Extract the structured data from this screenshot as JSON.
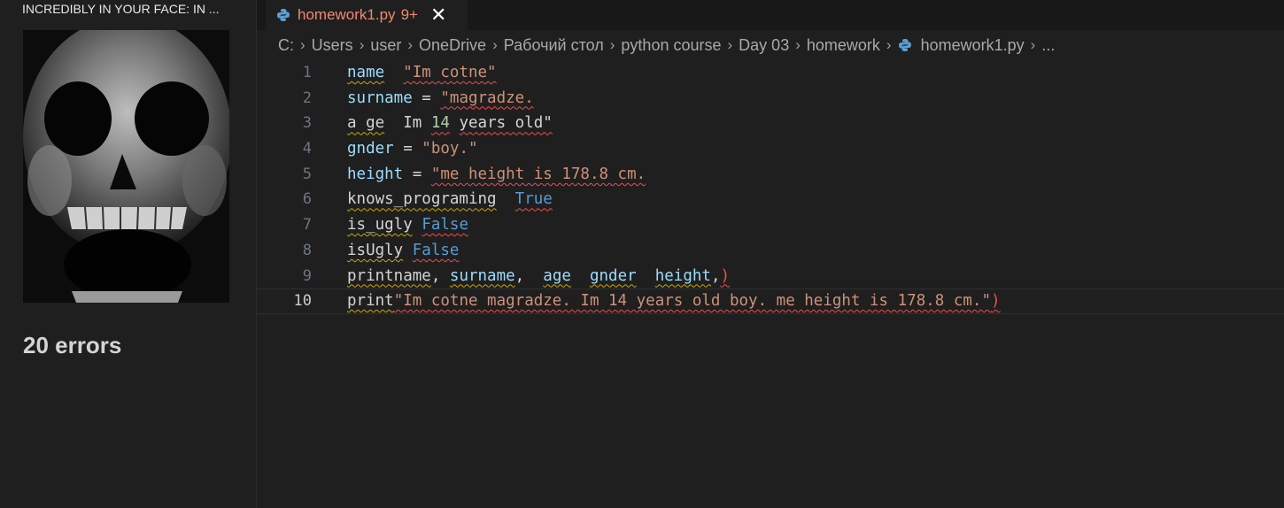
{
  "video_panel": {
    "title": "INCREDIBLY IN YOUR FACE: IN ...",
    "error_count": "20 errors"
  },
  "tab": {
    "filename": "homework1.py",
    "badge": "9+",
    "close_glyph": "✕"
  },
  "breadcrumb": [
    "C:",
    "Users",
    "user",
    "OneDrive",
    "Рабочий стол",
    "python course",
    "Day 03",
    "homework",
    "homework1.py",
    "..."
  ],
  "line_numbers": [
    "1",
    "2",
    "3",
    "4",
    "5",
    "6",
    "7",
    "8",
    "9",
    "10"
  ],
  "code": {
    "l1": [
      "name",
      "  ",
      "\"Im cotne\""
    ],
    "l2": [
      "surname",
      " = ",
      "\"magradze."
    ],
    "l3": [
      "a ge",
      "  Im ",
      "14",
      " ",
      "years old\""
    ],
    "l4": [
      "gnder",
      " = ",
      "\"boy.\""
    ],
    "l5": [
      "height",
      " = ",
      "\"me height is 178.8 cm."
    ],
    "l6": [
      "knows_programing",
      "  ",
      "True"
    ],
    "l7": [
      "is_ugly",
      " ",
      "False"
    ],
    "l8": [
      "isUgly",
      " ",
      "False"
    ],
    "l9": [
      "printname",
      ", ",
      "surname",
      ",  ",
      "age",
      "  ",
      "gnder",
      "  ",
      "height",
      ",",
      ")"
    ],
    "l10": [
      "print",
      "\"Im cotne magradze. Im 14 years old boy. me height is 178.8 cm.\"",
      ")"
    ]
  },
  "colors": {
    "variable": "#9cdcfe",
    "string": "#ce9178",
    "keyword": "#569cd6",
    "error": "#f14c4c",
    "warning": "#cca700",
    "tab_text": "#f48771"
  }
}
